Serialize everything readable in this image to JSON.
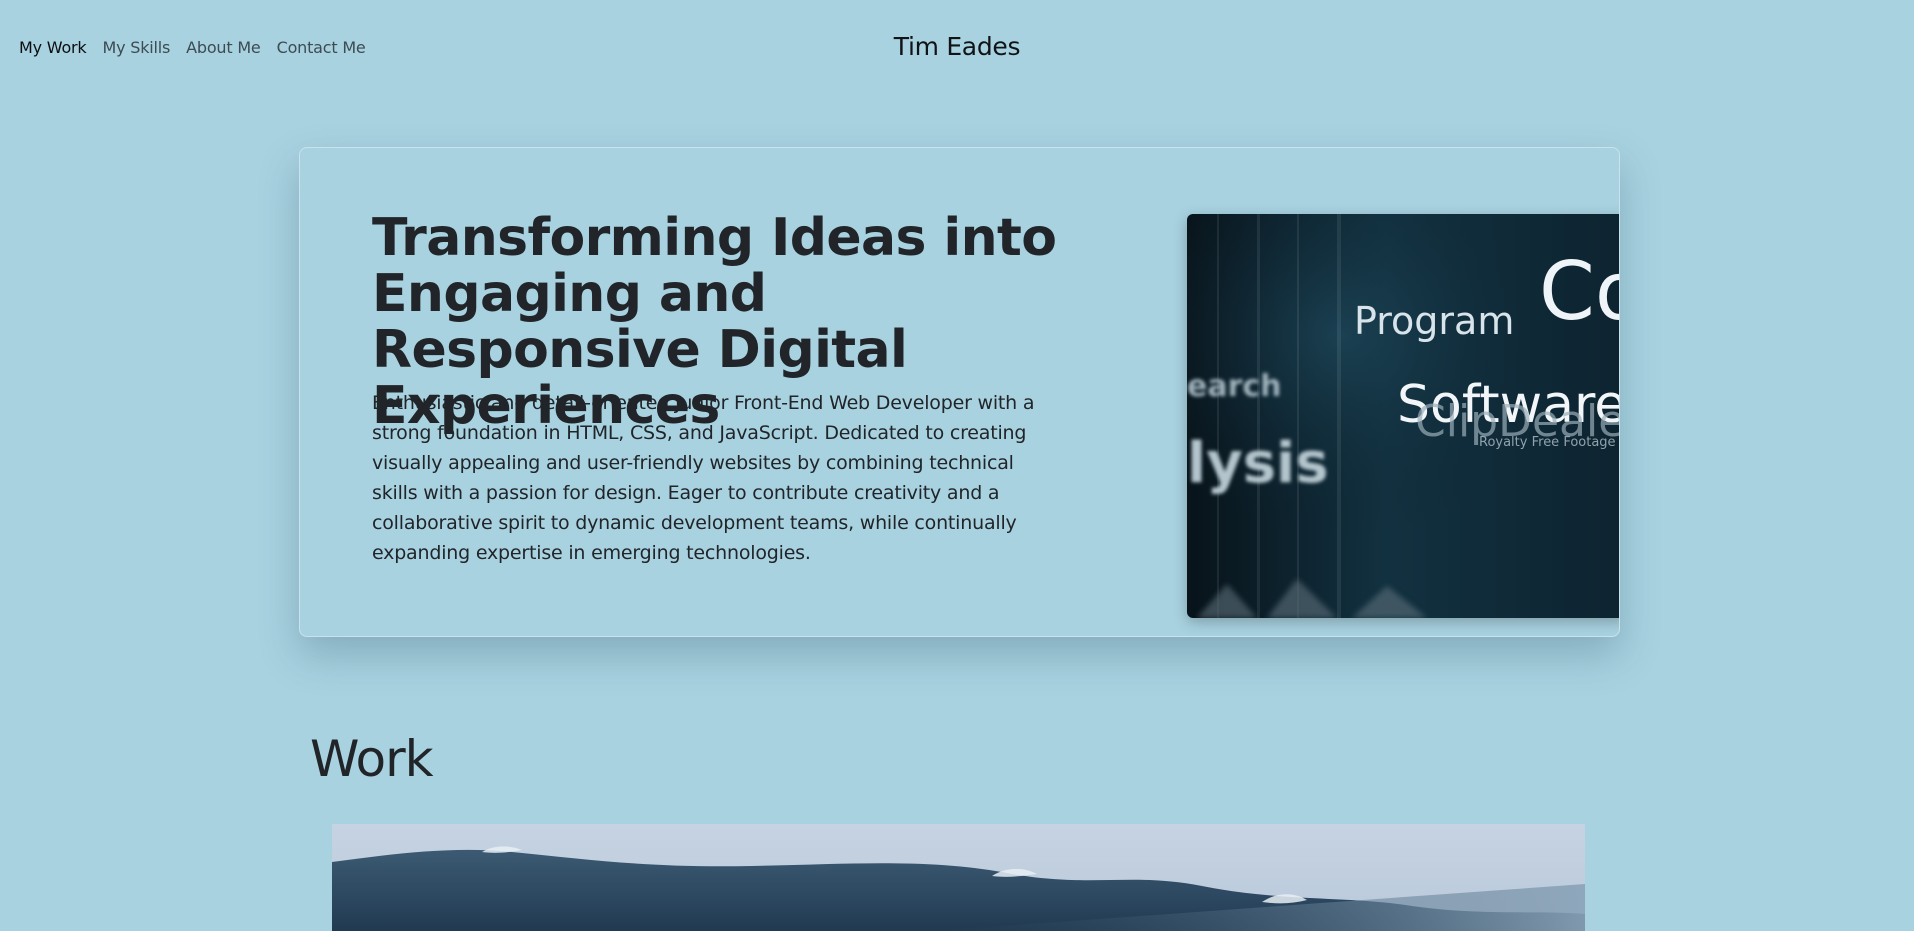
{
  "nav": {
    "links": [
      "My Work",
      "My Skills",
      "About Me",
      "Contact Me"
    ],
    "brand": "Tim Eades"
  },
  "hero": {
    "title": "Transforming Ideas into Engaging and Responsive Digital Experiences",
    "description": "Enthusiastic and detail-oriented Junior Front-End Web Developer with a strong foundation in HTML, CSS, and JavaScript. Dedicated to creating visually appealing and user-friendly websites by combining technical skills with a passion for design. Eager to contribute creativity and a collaborative spirit to dynamic development teams, while continually expanding expertise in emerging technologies.",
    "image": {
      "words": [
        "Program",
        "Co",
        "earch",
        "Software D",
        "lysis",
        "ClipDeale",
        "Royalty Free Footage Cli"
      ]
    }
  },
  "work": {
    "heading": "Work"
  },
  "colors": {
    "background": "#a8d2e0",
    "text": "#212529",
    "hero_image_bg": "#0f2633"
  }
}
